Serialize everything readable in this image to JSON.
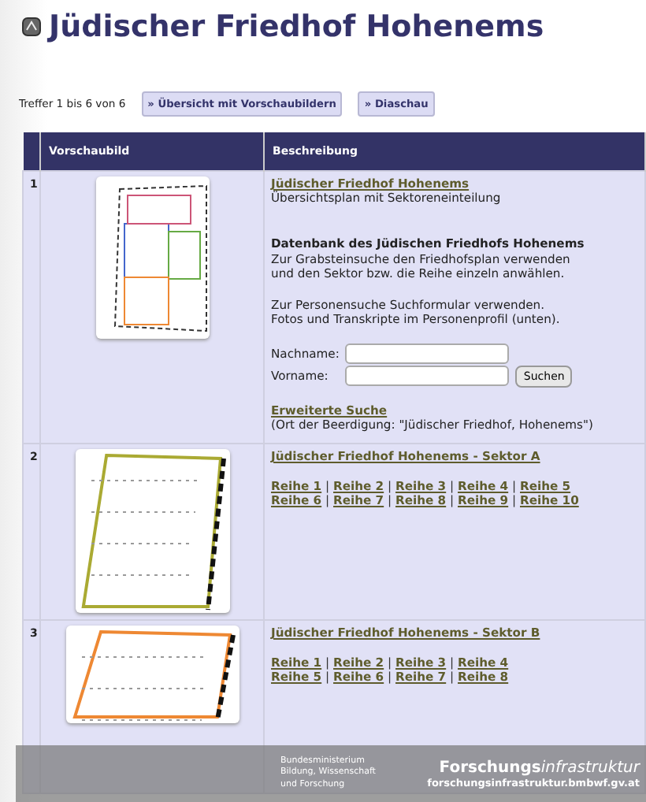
{
  "title": "Jüdischer Friedhof Hohenems",
  "result_count": "Treffer 1 bis 6 von 6",
  "buttons": [
    "» Übersicht mit Vorschaubildern",
    "» Diaschau"
  ],
  "table": {
    "columns": [
      "Vorschaubild",
      "Beschreibung"
    ],
    "rows": [
      {
        "kind": "search",
        "number": "1",
        "link": "Jüdischer Friedhof Hohenems",
        "subtitle": "Übersichtsplan mit Sektoreneinteilung",
        "heading": "Datenbank des Jüdischen Friedhofs Hohenems",
        "paragraphs": [
          "Zur Grabsteinsuche den Friedhofsplan verwenden\nund den Sektor bzw. die Reihe einzeln anwählen.",
          "Zur Personensuche Suchformular verwenden.\nFotos und Transkripte im Personenprofil (unten)."
        ],
        "fields": [
          {
            "label": "Nachname:"
          },
          {
            "label": "Vorname:"
          }
        ],
        "search_button": "Suchen",
        "extended_link": "Erweiterte Suche",
        "note": "(Ort der Beerdigung: \"Jüdischer Friedhof, Hohenems\")"
      },
      {
        "kind": "sector",
        "number": "2",
        "link": "Jüdischer Friedhof Hohenems - Sektor A",
        "separator": "|",
        "link_lines": [
          [
            "Reihe 1",
            "Reihe 2",
            "Reihe 3",
            "Reihe 4",
            "Reihe 5"
          ],
          [
            "Reihe 6",
            "Reihe 7",
            "Reihe 8",
            "Reihe 9",
            "Reihe 10"
          ]
        ]
      },
      {
        "kind": "sector",
        "number": "3",
        "link": "Jüdischer Friedhof Hohenems - Sektor B",
        "separator": "|",
        "link_lines": [
          [
            "Reihe 1",
            "Reihe 2",
            "Reihe 3",
            "Reihe 4"
          ],
          [
            "Reihe 5",
            "Reihe 6",
            "Reihe 7",
            "Reihe 8"
          ]
        ]
      }
    ]
  },
  "footer": {
    "ministry": "Bundesministerium\nBildung, Wissenschaft\nund Forschung",
    "brand": "Forschungs",
    "brand_italic": "infrastruktur",
    "url": "forschungsinfrastruktur.bmbwf.gv.at"
  }
}
